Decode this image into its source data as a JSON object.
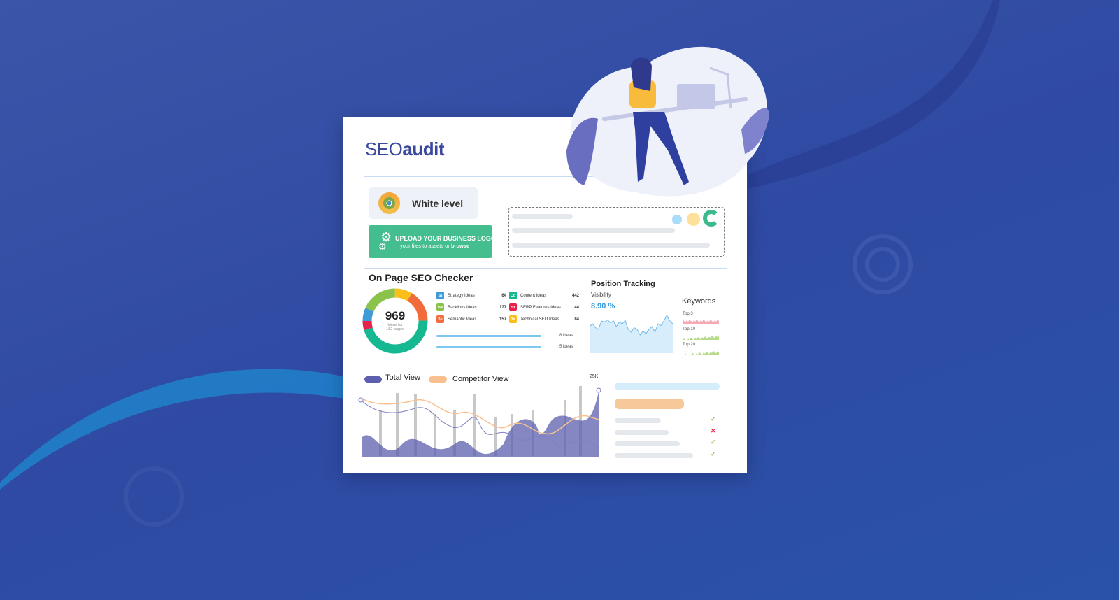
{
  "brand": {
    "logo_prefix": "SEO",
    "logo_suffix": "audit",
    "color": "#3a489e"
  },
  "level": {
    "label": "White level"
  },
  "upload": {
    "title": "UPLOAD YOUR BUSINESS LOGO",
    "subtitle": "your files to assets or",
    "link": "browse",
    "color": "#44be8e"
  },
  "seo_checker": {
    "title": "On Page SEO Checker",
    "total": "969",
    "total_caption_1": "ideas for",
    "total_caption_2": "182 pages",
    "items": [
      {
        "abbr": "St",
        "label": "Strategy Ideas",
        "value": "64",
        "color": "#3f9bd6"
      },
      {
        "abbr": "Ba",
        "label": "Backlinks Ideas",
        "value": "177",
        "color": "#8bc34a"
      },
      {
        "abbr": "Se",
        "label": "Semantic Ideas",
        "value": "157",
        "color": "#f26b3a"
      },
      {
        "abbr": "Co",
        "label": "Content Ideas",
        "value": "442",
        "color": "#15b890"
      },
      {
        "abbr": "Sf",
        "label": "SERP Features Ideas",
        "value": "44",
        "color": "#e8214b"
      },
      {
        "abbr": "Te",
        "label": "Technical SEO Ideas",
        "value": "84",
        "color": "#fbbf1a"
      }
    ],
    "progress": [
      {
        "label": "8 ideas"
      },
      {
        "label": "5 ideas"
      }
    ]
  },
  "position_tracking": {
    "title": "Position Tracking",
    "metric": "Visibility",
    "value": "8.90 %",
    "keywords_title": "Keywords",
    "keyword_rows": [
      "Top 3",
      "Top 10",
      "Top 20"
    ]
  },
  "traffic_chart": {
    "legend": [
      {
        "name": "Total View",
        "color": "#5b5fae"
      },
      {
        "name": "Competitor View",
        "color": "#f8c08f"
      }
    ],
    "max_label": "25K"
  },
  "checklist": {
    "status": [
      "check",
      "cross",
      "check",
      "check"
    ],
    "colors": {
      "check": "#8bc34a",
      "cross": "#e8214b"
    }
  }
}
